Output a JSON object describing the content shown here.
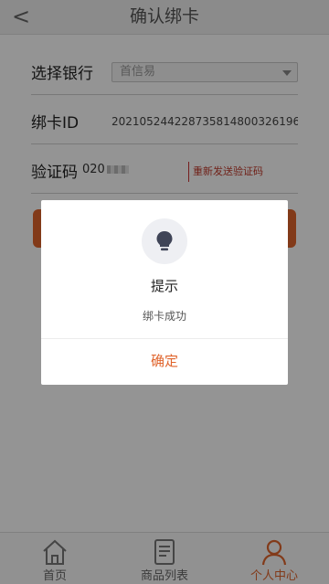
{
  "header": {
    "back_glyph": "<",
    "title": "确认绑卡"
  },
  "form": {
    "bank": {
      "label": "选择银行",
      "selected": "首信易"
    },
    "card": {
      "label": "绑卡ID",
      "value": "202105244228735814800326196"
    },
    "code": {
      "label": "验证码",
      "value": "020",
      "resend": "重新发送验证码"
    }
  },
  "tabs": [
    {
      "label": "首页",
      "icon": "home-icon",
      "active": false
    },
    {
      "label": "商品列表",
      "icon": "document-list-icon",
      "active": false
    },
    {
      "label": "个人中心",
      "icon": "user-icon",
      "active": true
    }
  ],
  "dialog": {
    "icon": "lightbulb-icon",
    "title": "提示",
    "message": "绑卡成功",
    "confirm": "确定"
  },
  "colors": {
    "accent": "#e0642c",
    "link_red": "#c0392b",
    "overlay": "rgba(0,0,0,0.42)"
  }
}
